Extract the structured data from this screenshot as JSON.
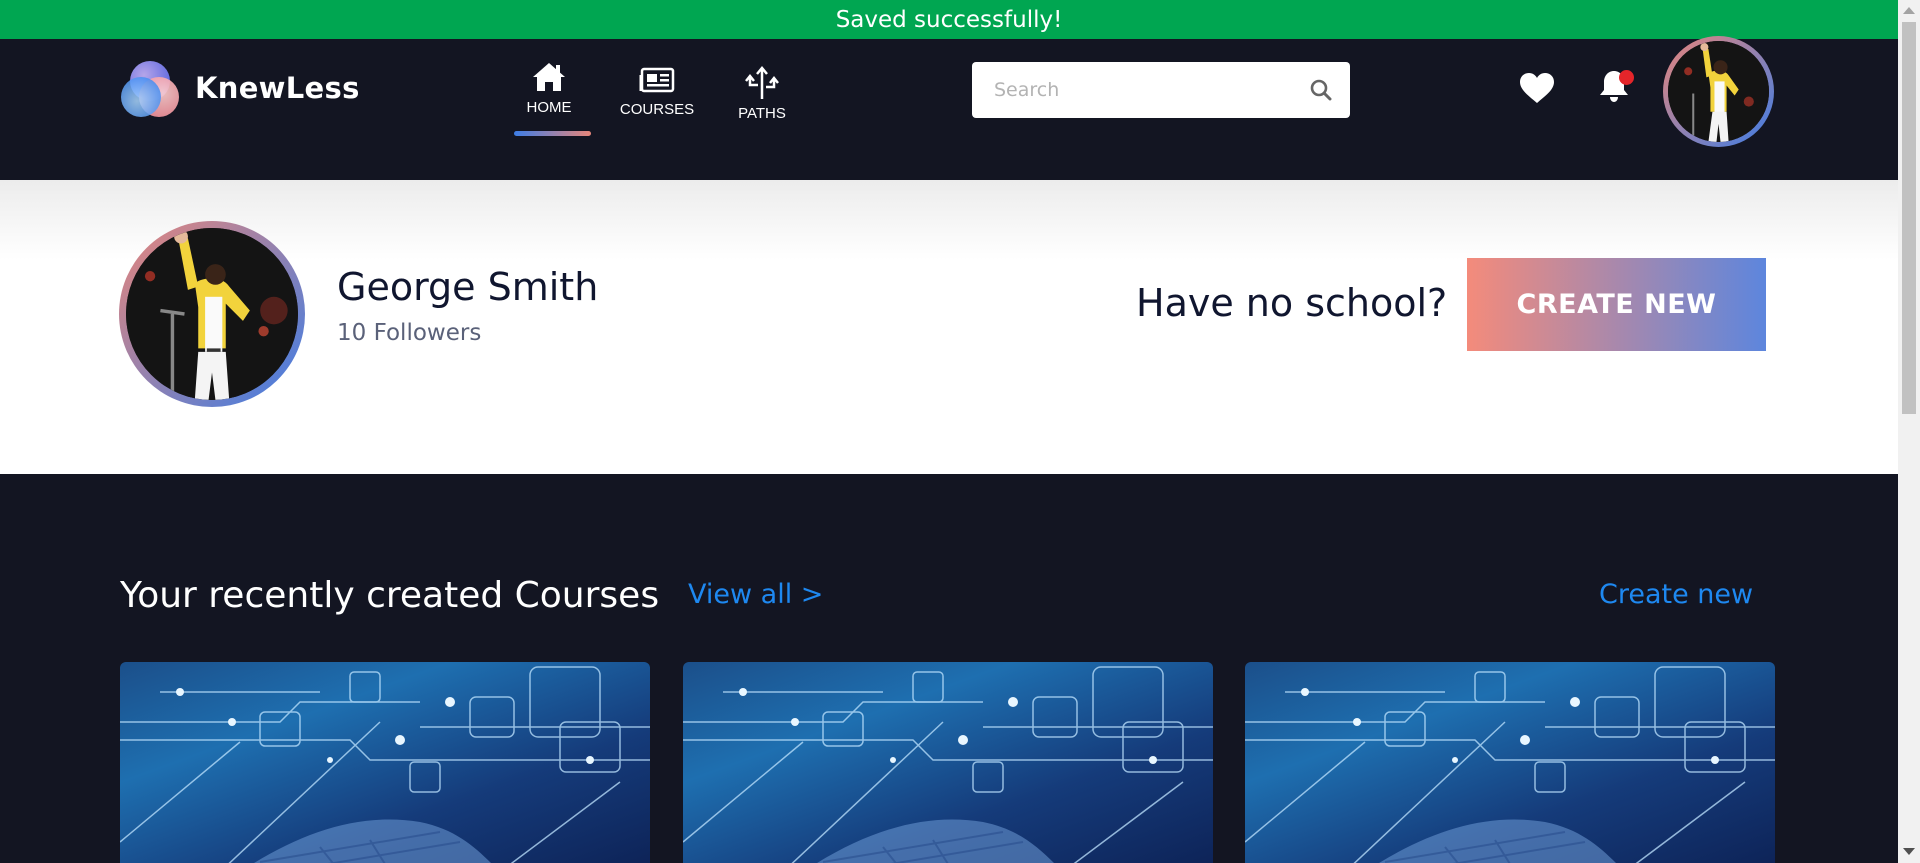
{
  "toast": {
    "message": "Saved successfully!"
  },
  "header": {
    "brand": "KnewLess",
    "nav": [
      {
        "label": "HOME",
        "icon": "home-icon",
        "active": true
      },
      {
        "label": "COURSES",
        "icon": "newspaper-icon",
        "active": false
      },
      {
        "label": "PATHS",
        "icon": "split-arrows-icon",
        "active": false
      }
    ],
    "search": {
      "placeholder": "Search",
      "value": ""
    },
    "icons": [
      "heart-icon",
      "bell-icon"
    ],
    "notification_dot": true
  },
  "profile": {
    "name": "George Smith",
    "followers": "10 Followers",
    "no_school_prompt": "Have no school?",
    "create_button": "CREATE NEW"
  },
  "courses_section": {
    "title": "Your recently created Courses",
    "view_all": "View all >",
    "create_new": "Create new",
    "cards": [
      {
        "image": "circuit-keyboard-image"
      },
      {
        "image": "circuit-keyboard-image"
      },
      {
        "image": "circuit-keyboard-image"
      }
    ]
  },
  "colors": {
    "toast": "#00a651",
    "header_bg": "#131522",
    "link": "#1e88f0",
    "gradient_start": "#f48b7b",
    "gradient_end": "#5d86dd"
  }
}
